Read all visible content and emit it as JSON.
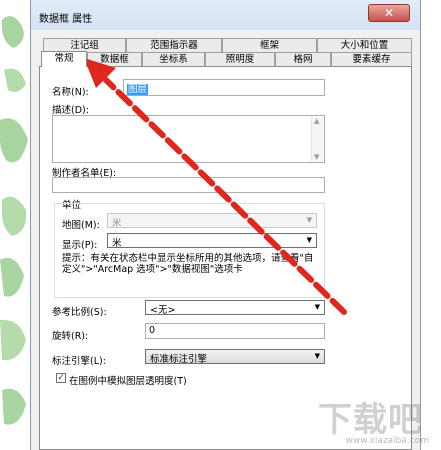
{
  "window": {
    "title": "数据框 属性",
    "close_label": "✕"
  },
  "tabs_row1": [
    "注记组",
    "范围指示器",
    "框架",
    "大小和位置"
  ],
  "tabs_row2": [
    "常规",
    "数据框",
    "坐标系",
    "照明度",
    "格网",
    "要素缓存"
  ],
  "active_tab": "常规",
  "general": {
    "name_label": "名称(N):",
    "name_value": "图层",
    "desc_label": "描述(D):",
    "credits_label": "制作者名单(E):",
    "units_group": "单位",
    "map_label": "地图(M):",
    "map_value": "米",
    "display_label": "显示(P):",
    "display_value": "米",
    "hint": "提示：有关在状态栏中显示坐标所用的其他选项，请查看\"自定义\">\"ArcMap 选项\">\"数据视图\"选项卡",
    "ref_scale_label": "参考比例(S):",
    "ref_scale_value": "<无>",
    "rotation_label": "旋转(R):",
    "rotation_value": "0",
    "label_engine_label": "标注引擎(L):",
    "label_engine_value": "标准标注引擎",
    "simulate_transparency_label": "在图例中模拟图层透明度(T)",
    "simulate_transparency_checked": true
  },
  "watermark": {
    "text": "下载吧",
    "url": "www.xiazaiba.com"
  },
  "colors": {
    "arrow": "#e0271d",
    "map_land": "#a8d4a0",
    "accent": "#1a3f8c"
  }
}
